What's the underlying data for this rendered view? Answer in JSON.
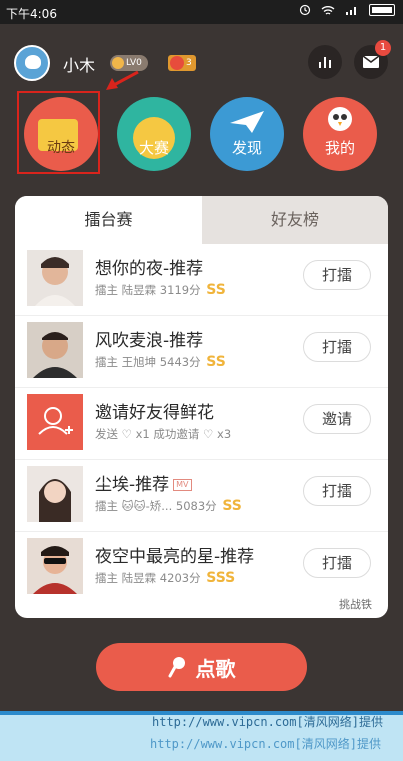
{
  "statusbar": {
    "time": "下午4:06"
  },
  "header": {
    "username": "小木",
    "level_badge": "LV0",
    "gift_count": "3",
    "notification_count": "1"
  },
  "shortcuts": [
    {
      "label": "动态"
    },
    {
      "label": "大赛"
    },
    {
      "label": "发现"
    },
    {
      "label": "我的"
    }
  ],
  "tabs": {
    "active": "擂台赛",
    "inactive": "好友榜"
  },
  "rows": [
    {
      "title": "想你的夜-推荐",
      "sub": "擂主 陆昱霖 3119分",
      "grade": "SS",
      "button": "打擂"
    },
    {
      "title": "风吹麦浪-推荐",
      "sub": "擂主 王旭坤 5443分",
      "grade": "SS",
      "button": "打擂"
    },
    {
      "title": "邀请好友得鲜花",
      "sub": "发送 ♡ x1   成功邀请 ♡ x3",
      "grade": "",
      "button": "邀请"
    },
    {
      "title": "尘埃-推荐",
      "mv": "MV",
      "sub": "擂主 🐱🐱-矫...   5083分",
      "grade": "SS",
      "button": "打擂"
    },
    {
      "title": "夜空中最亮的星-推荐",
      "sub": "擂主 陆昱霖 4203分",
      "grade": "SSS",
      "button": "打擂"
    }
  ],
  "footer_link": "挑战铁",
  "main_button": {
    "label": "点歌"
  },
  "watermark": {
    "line1": "http://www.vipcn.com[清风网络]提供",
    "line2": "http://www.vipcn.com[清风网络]提供"
  }
}
